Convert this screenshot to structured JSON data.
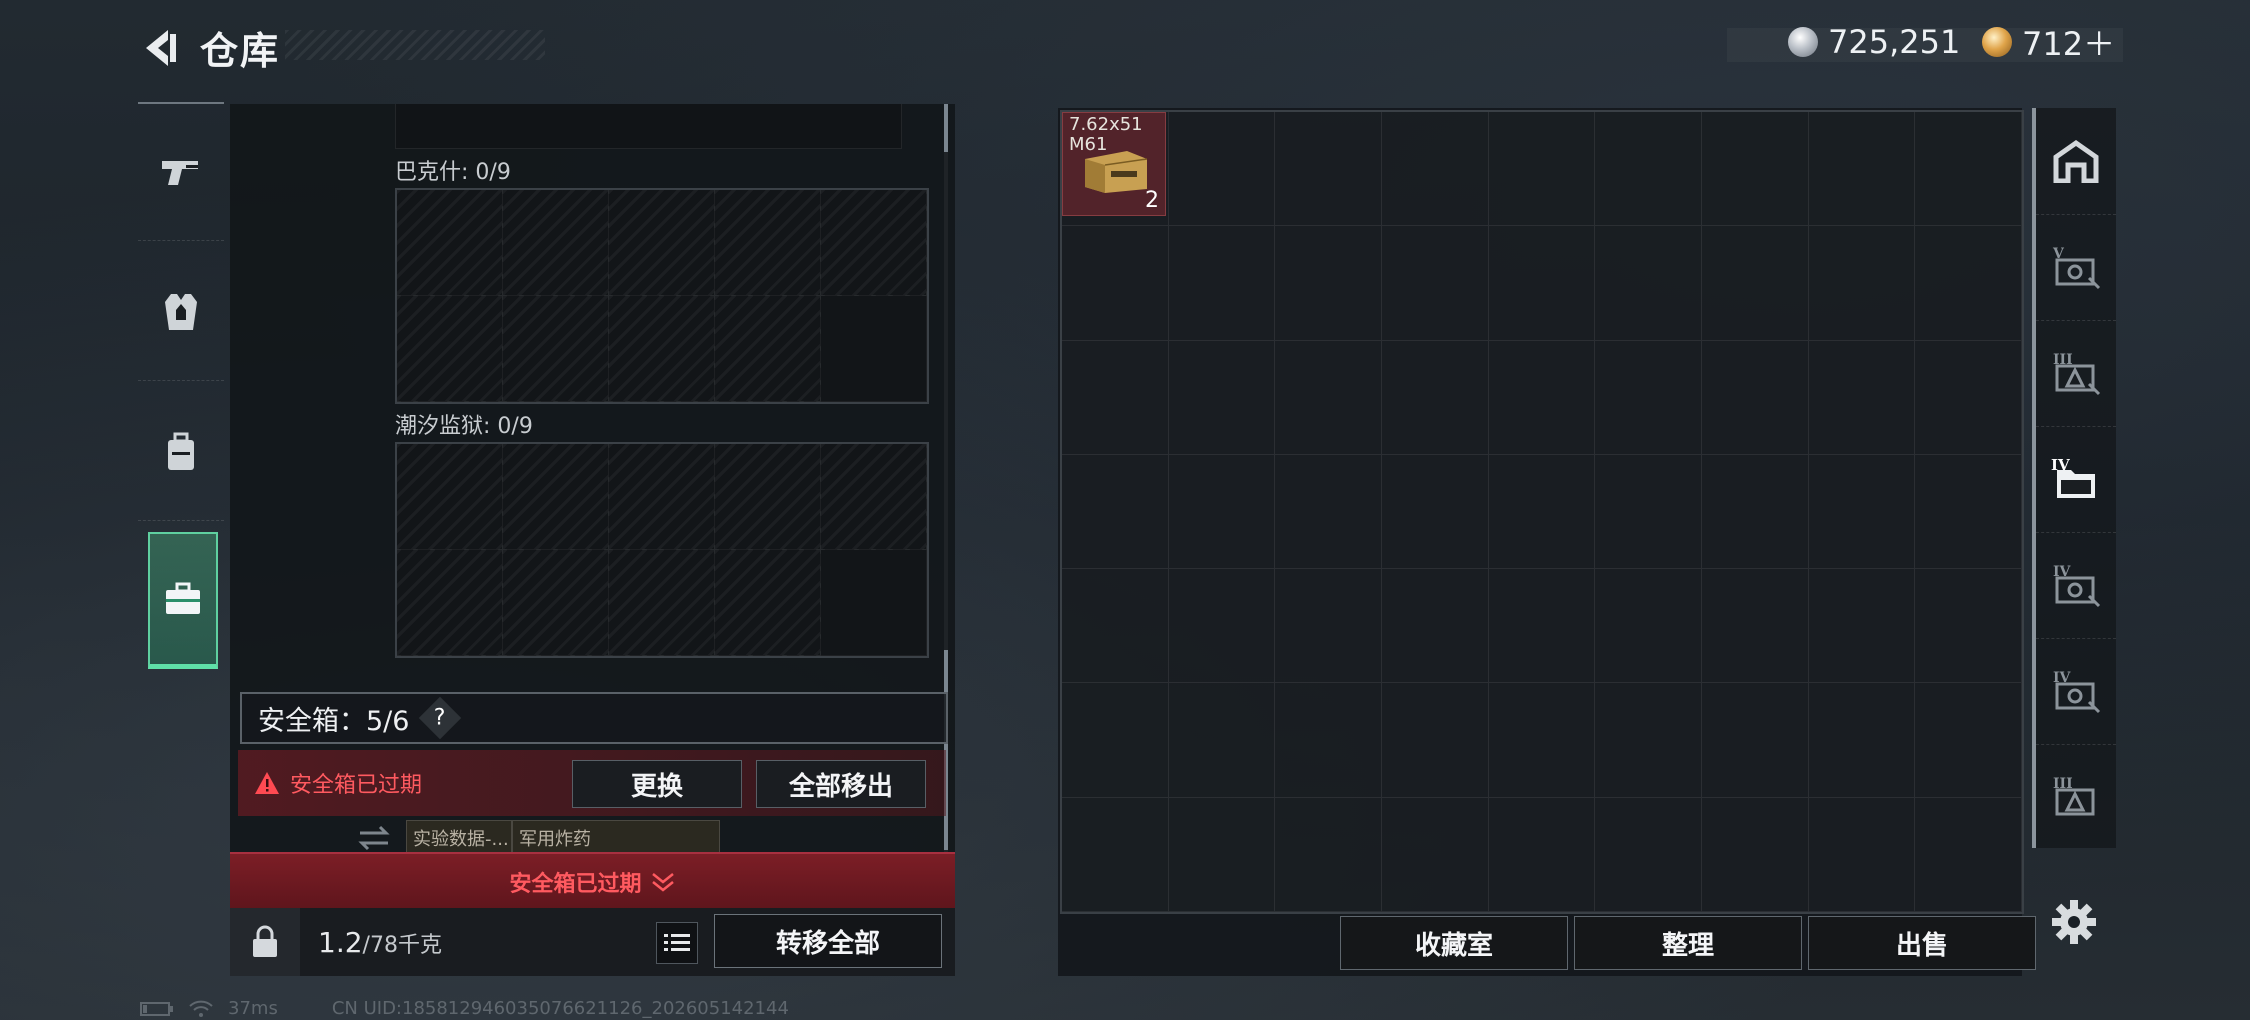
{
  "header": {
    "title": "仓库",
    "currency": [
      {
        "icon": "silver-coin-icon",
        "value": "725,251"
      },
      {
        "icon": "gold-coin-icon",
        "value": "712＋"
      }
    ]
  },
  "left_sidebar": {
    "categories": [
      {
        "icon": "pistol-icon"
      },
      {
        "icon": "armor-vest-icon"
      },
      {
        "icon": "backpack-icon"
      },
      {
        "icon": "briefcase-icon",
        "active": true
      }
    ]
  },
  "container_sections": [
    {
      "label": "巴克什: 0/9"
    },
    {
      "label": "潮汐监狱: 0/9"
    }
  ],
  "safebox": {
    "label": "安全箱：5/6",
    "help": "?",
    "expired_text": "安全箱已过期",
    "replace_button": "更换",
    "move_all_button": "全部移出",
    "items": [
      "实验数据-...",
      "军用炸药"
    ],
    "banner_text": "安全箱已过期"
  },
  "bottom_bar": {
    "weight_value": "1.2",
    "weight_capacity": "/78千克",
    "transfer_all_button": "转移全部"
  },
  "stash": {
    "item": {
      "name": "7.62x51 M61",
      "count": "2"
    },
    "buttons": {
      "collection": "收藏室",
      "sort": "整理",
      "sell": "出售"
    }
  },
  "right_tabs": [
    {
      "icon": "stash-home-icon",
      "roman": ""
    },
    {
      "icon": "stash-tab-v-icon",
      "roman": "V"
    },
    {
      "icon": "stash-tab-iii-icon",
      "roman": "III"
    },
    {
      "icon": "stash-tab-iv-active-icon",
      "roman": "IV"
    },
    {
      "icon": "stash-tab-iv-icon",
      "roman": "IV"
    },
    {
      "icon": "stash-tab-iv-b-icon",
      "roman": "IV"
    },
    {
      "icon": "stash-tab-iii-b-icon",
      "roman": "III"
    }
  ],
  "status": {
    "ping": "37ms",
    "uid": "CN UID:185812946035076621126_202605142144"
  },
  "colors": {
    "accent_green": "#5fe0a8",
    "warning_red": "#ff5a60",
    "expired_bg": "#7c1e26"
  }
}
